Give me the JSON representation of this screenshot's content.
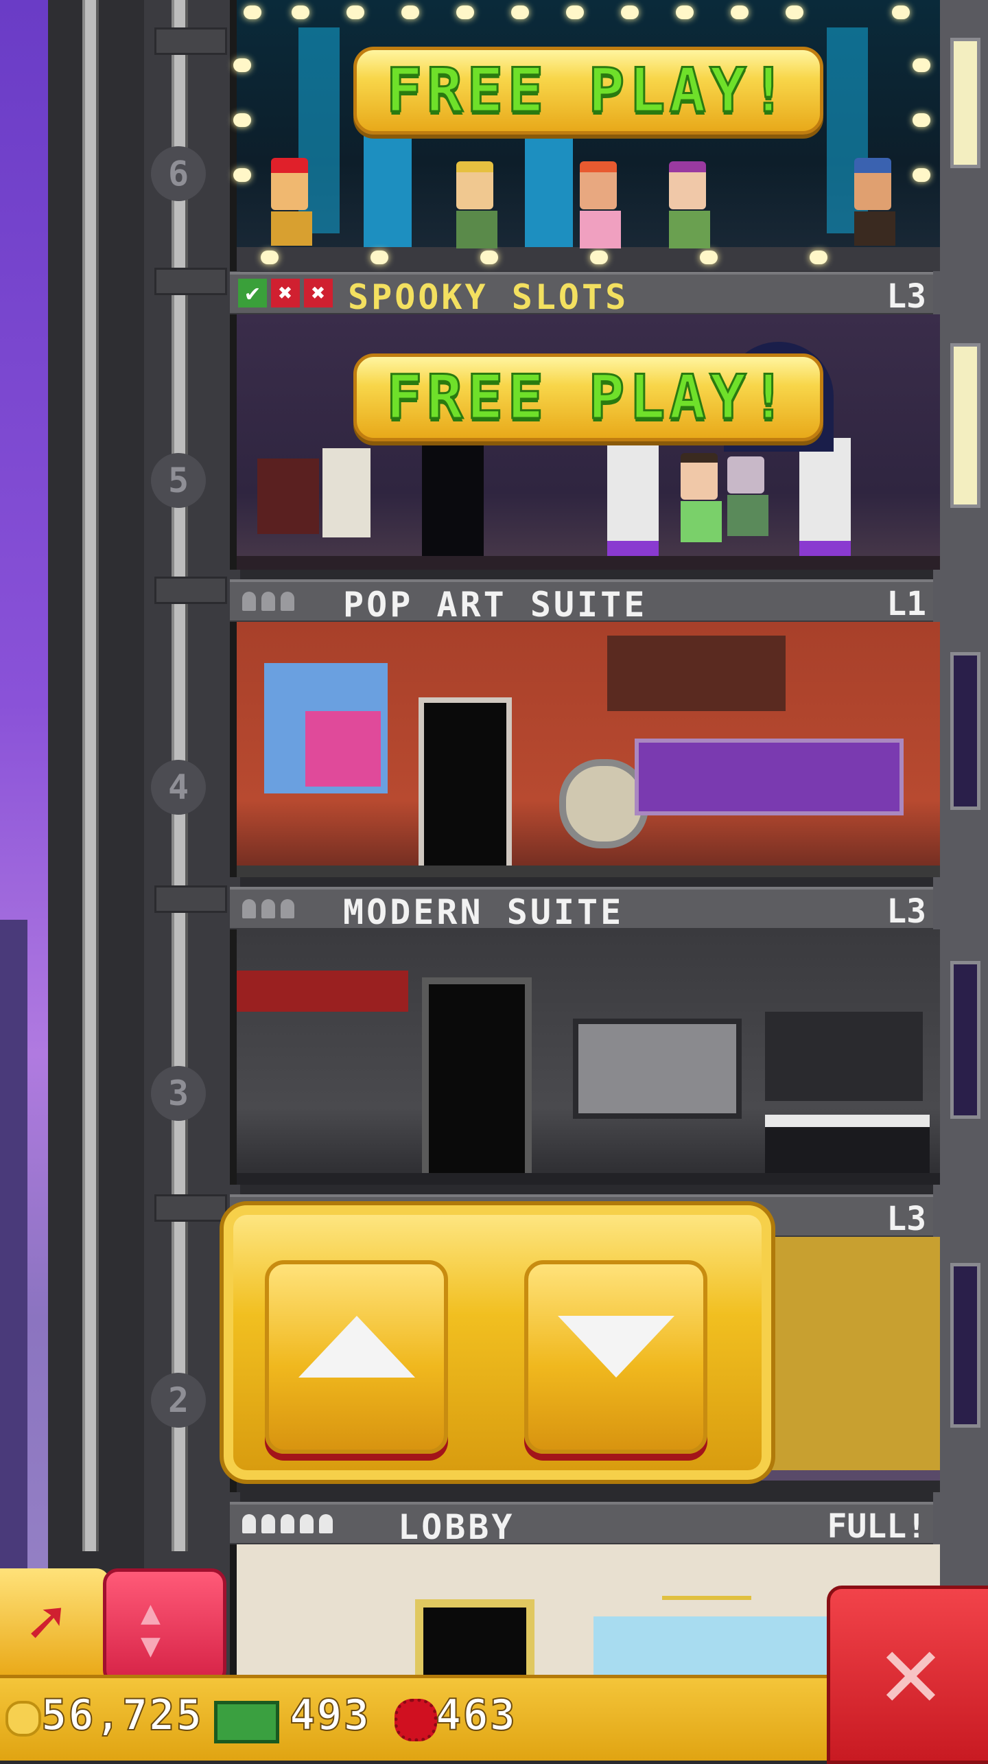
{
  "shaft": {
    "floor_numbers": [
      "6",
      "5",
      "4",
      "3",
      "2"
    ]
  },
  "floors": {
    "floor6": {
      "button": "FREE PLAY!"
    },
    "spooky": {
      "name": "SPOOKY SLOTS",
      "level": "L3",
      "button": "FREE PLAY!",
      "stock_status": [
        "check",
        "x",
        "x"
      ]
    },
    "popart": {
      "name": "POP ART SUITE",
      "level": "L1",
      "occupants": 0,
      "capacity": 3
    },
    "modern": {
      "name": "MODERN SUITE",
      "level": "L3",
      "occupants": 0,
      "capacity": 3
    },
    "floor2": {
      "level": "L3"
    },
    "lobby": {
      "name": "LOBBY",
      "status": "FULL!",
      "occupants": 5,
      "capacity": 5
    }
  },
  "elevator": {
    "up_icon": "arrow-up",
    "down_icon": "arrow-down"
  },
  "hud": {
    "coins": "56,725",
    "bux": "493",
    "tokens": "463"
  },
  "colors": {
    "gold": "#f1bf20",
    "free_play_text": "#6fe02a",
    "close_red": "#e0262e",
    "sky_purple": "#7a48d0"
  }
}
